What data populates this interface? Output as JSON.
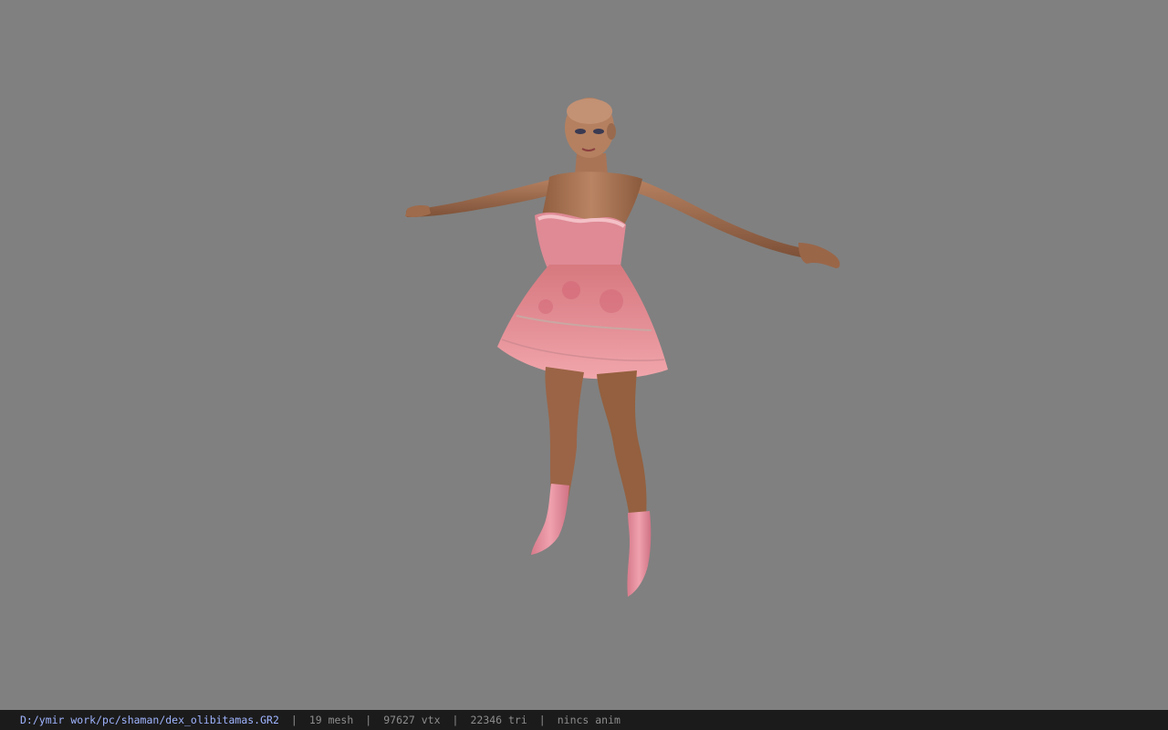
{
  "viewport": {
    "background_color": "#808080",
    "model": {
      "icon": "character-model",
      "skin_color": "#b07a56",
      "dress_color": "#e9959c",
      "boots_color": "#e78f9c"
    }
  },
  "status_bar": {
    "file_path": "D:/ymir work/pc/shaman/dex_olibitamas.GR2",
    "mesh": "19 mesh",
    "vtx": "97627 vtx",
    "tri": "22346 tri",
    "anim": "nincs anim",
    "separator": "|",
    "path_color": "#9fb4ff",
    "text_color": "#8d8d8d"
  }
}
